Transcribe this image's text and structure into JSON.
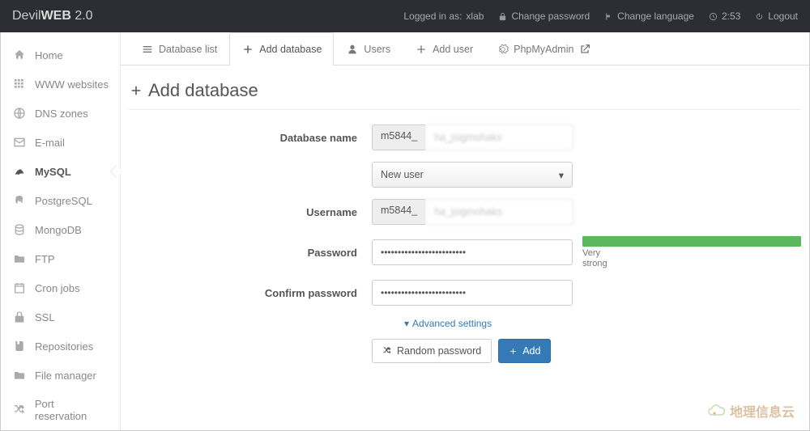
{
  "brand": {
    "name": "Devil",
    "name2": "WEB",
    "ver": " 2.0"
  },
  "top": {
    "logged": "Logged in as: ",
    "user": "xlab",
    "pwd": "Change password",
    "lang": "Change language",
    "time": "2:53",
    "logout": "Logout"
  },
  "sidebar": [
    {
      "label": "Home",
      "icon": "home"
    },
    {
      "label": "WWW websites",
      "icon": "grid"
    },
    {
      "label": "DNS zones",
      "icon": "globe"
    },
    {
      "label": "E-mail",
      "icon": "mail"
    },
    {
      "label": "MySQL",
      "icon": "mysql",
      "active": true
    },
    {
      "label": "PostgreSQL",
      "icon": "pg"
    },
    {
      "label": "MongoDB",
      "icon": "db"
    },
    {
      "label": "FTP",
      "icon": "folder"
    },
    {
      "label": "Cron jobs",
      "icon": "cal"
    },
    {
      "label": "SSL",
      "icon": "lock"
    },
    {
      "label": "Repositories",
      "icon": "repo"
    },
    {
      "label": "File manager",
      "icon": "folder"
    },
    {
      "label": "Port reservation",
      "icon": "shuffle"
    }
  ],
  "tabs": [
    {
      "label": "Database list",
      "icon": "list"
    },
    {
      "label": "Add database",
      "icon": "plus",
      "active": true
    },
    {
      "label": "Users",
      "icon": "user"
    },
    {
      "label": "Add user",
      "icon": "plus"
    },
    {
      "label": "PhpMyAdmin",
      "icon": "ext"
    }
  ],
  "page": {
    "title": "Add database",
    "labels": {
      "dbname": "Database name",
      "username": "Username",
      "password": "Password",
      "confirm": "Confirm password"
    },
    "prefix": "m5844_",
    "user_select": "New user",
    "dbname_val": "ha_jsigmohaks",
    "username_val": "ha_jsigmohaks",
    "pw_mask": "•••••••••••••••••••••••••",
    "strength": "Very strong",
    "adv": "Advanced settings",
    "btn_random": "Random password",
    "btn_add": "Add"
  },
  "watermark": "地理信息云"
}
